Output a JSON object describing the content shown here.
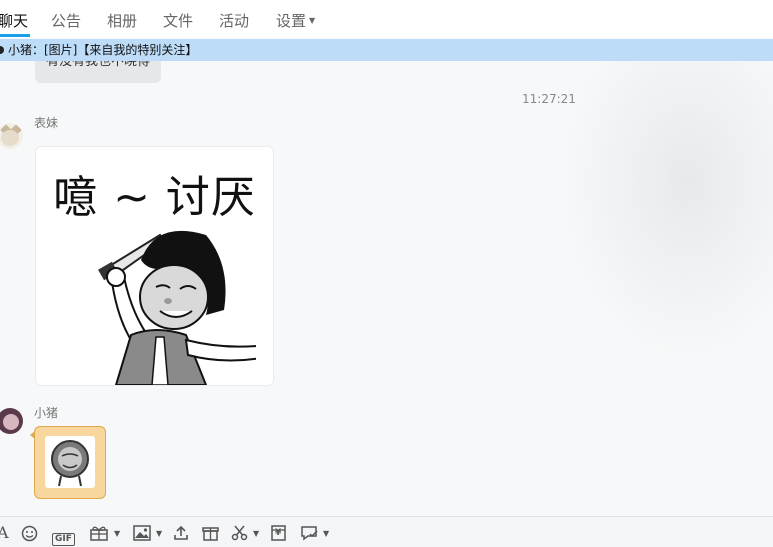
{
  "tabs": [
    {
      "label": "聊天",
      "active": true
    },
    {
      "label": "公告"
    },
    {
      "label": "相册"
    },
    {
      "label": "文件"
    },
    {
      "label": "活动"
    },
    {
      "label": "设置",
      "has_dropdown": true
    }
  ],
  "notice": {
    "text": "小猪：[图片]【来自我的特别关注】"
  },
  "chat": {
    "previous_bubble_text": "有没有我也不晓得",
    "timestamp": "11:27:21",
    "messages": [
      {
        "sender": "表妹",
        "type": "sticker",
        "caption": "噫 ~ 讨厌",
        "avatar": "cat-avatar"
      },
      {
        "sender": "小猪",
        "type": "sticker-small",
        "avatar": "pig-avatar"
      }
    ]
  },
  "toolbar": {
    "items": [
      {
        "icon": "font-icon",
        "text": "A"
      },
      {
        "icon": "emoji-icon"
      },
      {
        "icon": "gif-icon",
        "text": "GIF"
      },
      {
        "icon": "gift-box-icon",
        "has_dropdown": true
      },
      {
        "icon": "image-icon",
        "has_dropdown": true
      },
      {
        "icon": "upload-icon"
      },
      {
        "icon": "present-icon"
      },
      {
        "icon": "scissors-icon",
        "has_dropdown": true
      },
      {
        "icon": "red-packet-icon",
        "text": "¥"
      },
      {
        "icon": "chat-history-icon",
        "has_dropdown": true
      }
    ]
  },
  "colors": {
    "accent": "#1aa0e6",
    "notice_bg": "#bcdcf7",
    "sticker_bubble": "#f7d79d"
  }
}
